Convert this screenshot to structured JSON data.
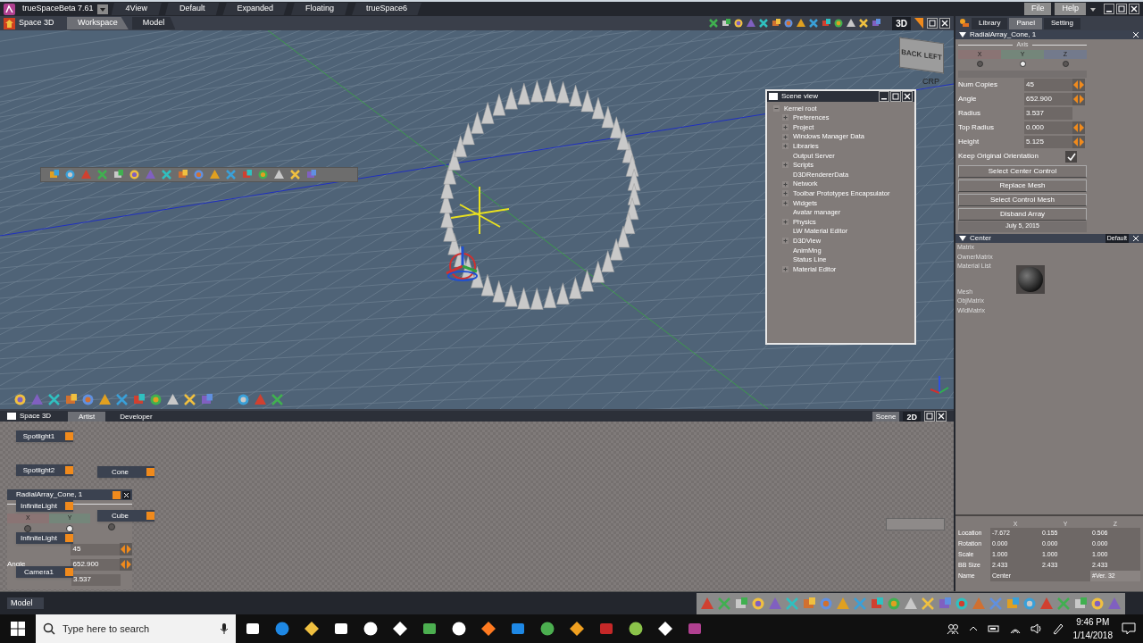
{
  "title_bar": {
    "app_title": "trueSpaceBeta 7.61",
    "layouts": [
      {
        "label": "4View"
      },
      {
        "label": "Default"
      },
      {
        "label": "Expanded"
      },
      {
        "label": "Floating"
      },
      {
        "label": "trueSpace6"
      }
    ],
    "menus": [
      {
        "label": "File"
      },
      {
        "label": "Help"
      }
    ]
  },
  "workspace_bar": {
    "space_label": "Space 3D",
    "tabs": [
      {
        "label": "Workspace",
        "selected": true
      },
      {
        "label": "Model",
        "selected": false
      }
    ],
    "view_mode": "3D"
  },
  "side_tabs": [
    {
      "label": "Library",
      "selected": false
    },
    {
      "label": "Panel",
      "selected": true
    },
    {
      "label": "Setting",
      "selected": false
    }
  ],
  "viewport": {
    "cube_faces": [
      "BACK",
      "LEFT"
    ],
    "corner_label": "CRP"
  },
  "scene_view": {
    "title": "Scene view",
    "tree": {
      "label": "Kernel root",
      "expandable": true,
      "expanded": true,
      "children": [
        {
          "label": "Preferences",
          "expandable": true
        },
        {
          "label": "Project",
          "expandable": true
        },
        {
          "label": "Windows Manager Data",
          "expandable": true
        },
        {
          "label": "Libraries",
          "expandable": true
        },
        {
          "label": "Output Server",
          "expandable": false
        },
        {
          "label": "Scripts",
          "expandable": true
        },
        {
          "label": "D3DRendererData",
          "expandable": false
        },
        {
          "label": "Network",
          "expandable": true
        },
        {
          "label": "Toolbar Prototypes Encapsulator",
          "expandable": true
        },
        {
          "label": "Widgets",
          "expandable": true
        },
        {
          "label": "Avatar manager",
          "expandable": false
        },
        {
          "label": "Physics",
          "expandable": true
        },
        {
          "label": "LW Material Editor",
          "expandable": false
        },
        {
          "label": "D3DView",
          "expandable": true
        },
        {
          "label": "AnimMng",
          "expandable": false
        },
        {
          "label": "Status Line",
          "expandable": false
        },
        {
          "label": "Material Editor",
          "expandable": true
        }
      ]
    }
  },
  "radial_array_panel": {
    "title": "RadialArray_Cone, 1",
    "axis_label": "Axis",
    "axes": [
      {
        "label": "X",
        "selected": false,
        "color": "#8a7474"
      },
      {
        "label": "Y",
        "selected": true,
        "color": "#74867a"
      },
      {
        "label": "Z",
        "selected": false,
        "color": "#737a8c"
      }
    ],
    "fields": [
      {
        "label": "Num Copies",
        "value": "45",
        "spinner": true
      },
      {
        "label": "Angle",
        "value": "652.900",
        "spinner": true
      },
      {
        "label": "Radius",
        "value": "3.537",
        "spinner": false
      },
      {
        "label": "Top Radius",
        "value": "0.000",
        "spinner": true
      },
      {
        "label": "Height",
        "value": "5.125",
        "spinner": true
      }
    ],
    "keep_orientation": {
      "label": "Keep Original Orientation",
      "checked": true
    },
    "buttons": [
      {
        "label": "Select Center Control"
      },
      {
        "label": "Replace Mesh"
      },
      {
        "label": "Select Control Mesh"
      },
      {
        "label": "Disband Array"
      }
    ],
    "date": "July 5, 2015"
  },
  "center_panel": {
    "title": "Center",
    "preset": "Default",
    "items": [
      "Matrix",
      "OwnerMatrix",
      "Material List",
      "Mesh",
      "ObjMatrix",
      "WldMatrix"
    ]
  },
  "transform": {
    "columns": [
      "X",
      "Y",
      "Z"
    ],
    "rows": [
      {
        "label": "Location",
        "values": [
          "-7.672",
          "0.155",
          "0.506"
        ]
      },
      {
        "label": "Rotation",
        "values": [
          "0.000",
          "0.000",
          "0.000"
        ]
      },
      {
        "label": "Scale",
        "values": [
          "1.000",
          "1.000",
          "1.000"
        ]
      },
      {
        "label": "BB Size",
        "values": [
          "2.433",
          "2.433",
          "2.433"
        ]
      }
    ],
    "name_label": "Name",
    "name_value": "Center",
    "version": "#Ver. 32"
  },
  "bottom_panel": {
    "space_label": "Space 3D",
    "tabs": [
      {
        "label": "Artist",
        "selected": true
      },
      {
        "label": "Developer",
        "selected": false
      }
    ],
    "right_tabs": [
      {
        "label": "Scene",
        "selected": true
      },
      {
        "label": "2D",
        "selected": false
      }
    ],
    "array_overlay": {
      "title": "RadialArray_Cone, 1",
      "axes": [
        {
          "label": "X",
          "selected": false,
          "color": "#8a7474"
        },
        {
          "label": "Y",
          "selected": true,
          "color": "#74867a"
        },
        {
          "selected": false
        }
      ],
      "fields": [
        {
          "value": "45",
          "spinner": true
        },
        {
          "label": "Angle",
          "value": "652.900",
          "spinner": true
        },
        {
          "value": "3.537",
          "spinner": false
        }
      ]
    },
    "nodes": [
      {
        "label": "Spotlight1"
      },
      {
        "label": "Spotlight2"
      },
      {
        "label": "Cone"
      },
      {
        "label": "InfiniteLight"
      },
      {
        "label": "Cube"
      },
      {
        "label": "InfiniteLight"
      },
      {
        "label": "Camera1"
      }
    ]
  },
  "status_bar": {
    "mode": "Model"
  },
  "taskbar": {
    "search_placeholder": "Type here to search",
    "time": "9:46 PM",
    "date": "1/14/2018"
  }
}
